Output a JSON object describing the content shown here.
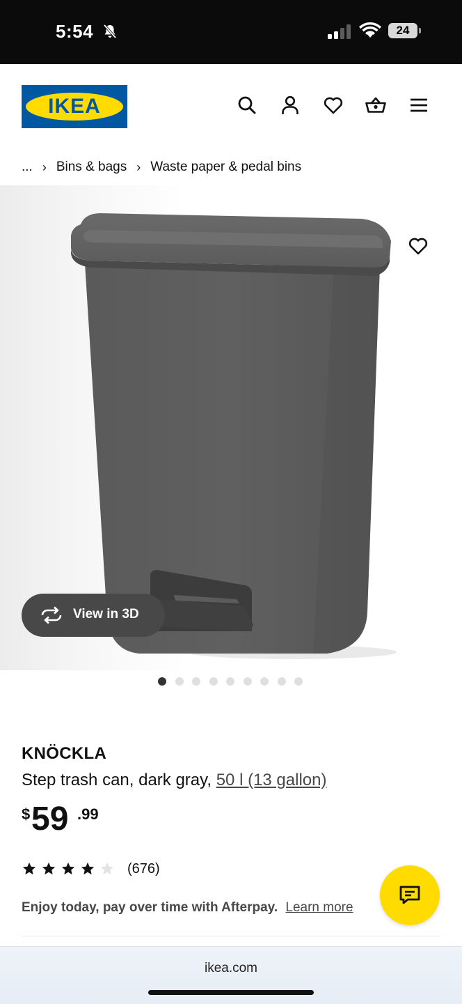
{
  "status_bar": {
    "time": "5:54",
    "battery": "24",
    "icons": [
      "bell-slash-icon",
      "signal-icon",
      "wifi-icon",
      "battery-icon"
    ]
  },
  "header": {
    "logo_text": "IKEA",
    "icons": [
      "search-icon",
      "account-icon",
      "heart-icon",
      "basket-icon",
      "menu-icon"
    ]
  },
  "breadcrumb": {
    "items": [
      "...",
      "Bins & bags",
      "Waste paper & pedal bins"
    ]
  },
  "gallery": {
    "view_3d_label": "View in 3D",
    "image_count": 9,
    "active_index": 0
  },
  "product": {
    "name": "KNÖCKLA",
    "description": "Step trash can, dark gray,",
    "measure": "50 l (13 gallon)",
    "price": {
      "currency": "$",
      "integer": "59",
      "decimal": ".99"
    },
    "rating": {
      "stars": 4,
      "max_stars": 5,
      "count": "(676)"
    },
    "afterpay_text": "Enjoy today, pay over time with Afterpay.",
    "afterpay_link": "Learn more"
  },
  "browser": {
    "url": "ikea.com"
  },
  "colors": {
    "ikea_blue": "#0058a3",
    "ikea_yellow": "#ffdb00",
    "status_bar": "#0b0b0b",
    "pill_bg": "#484848"
  }
}
